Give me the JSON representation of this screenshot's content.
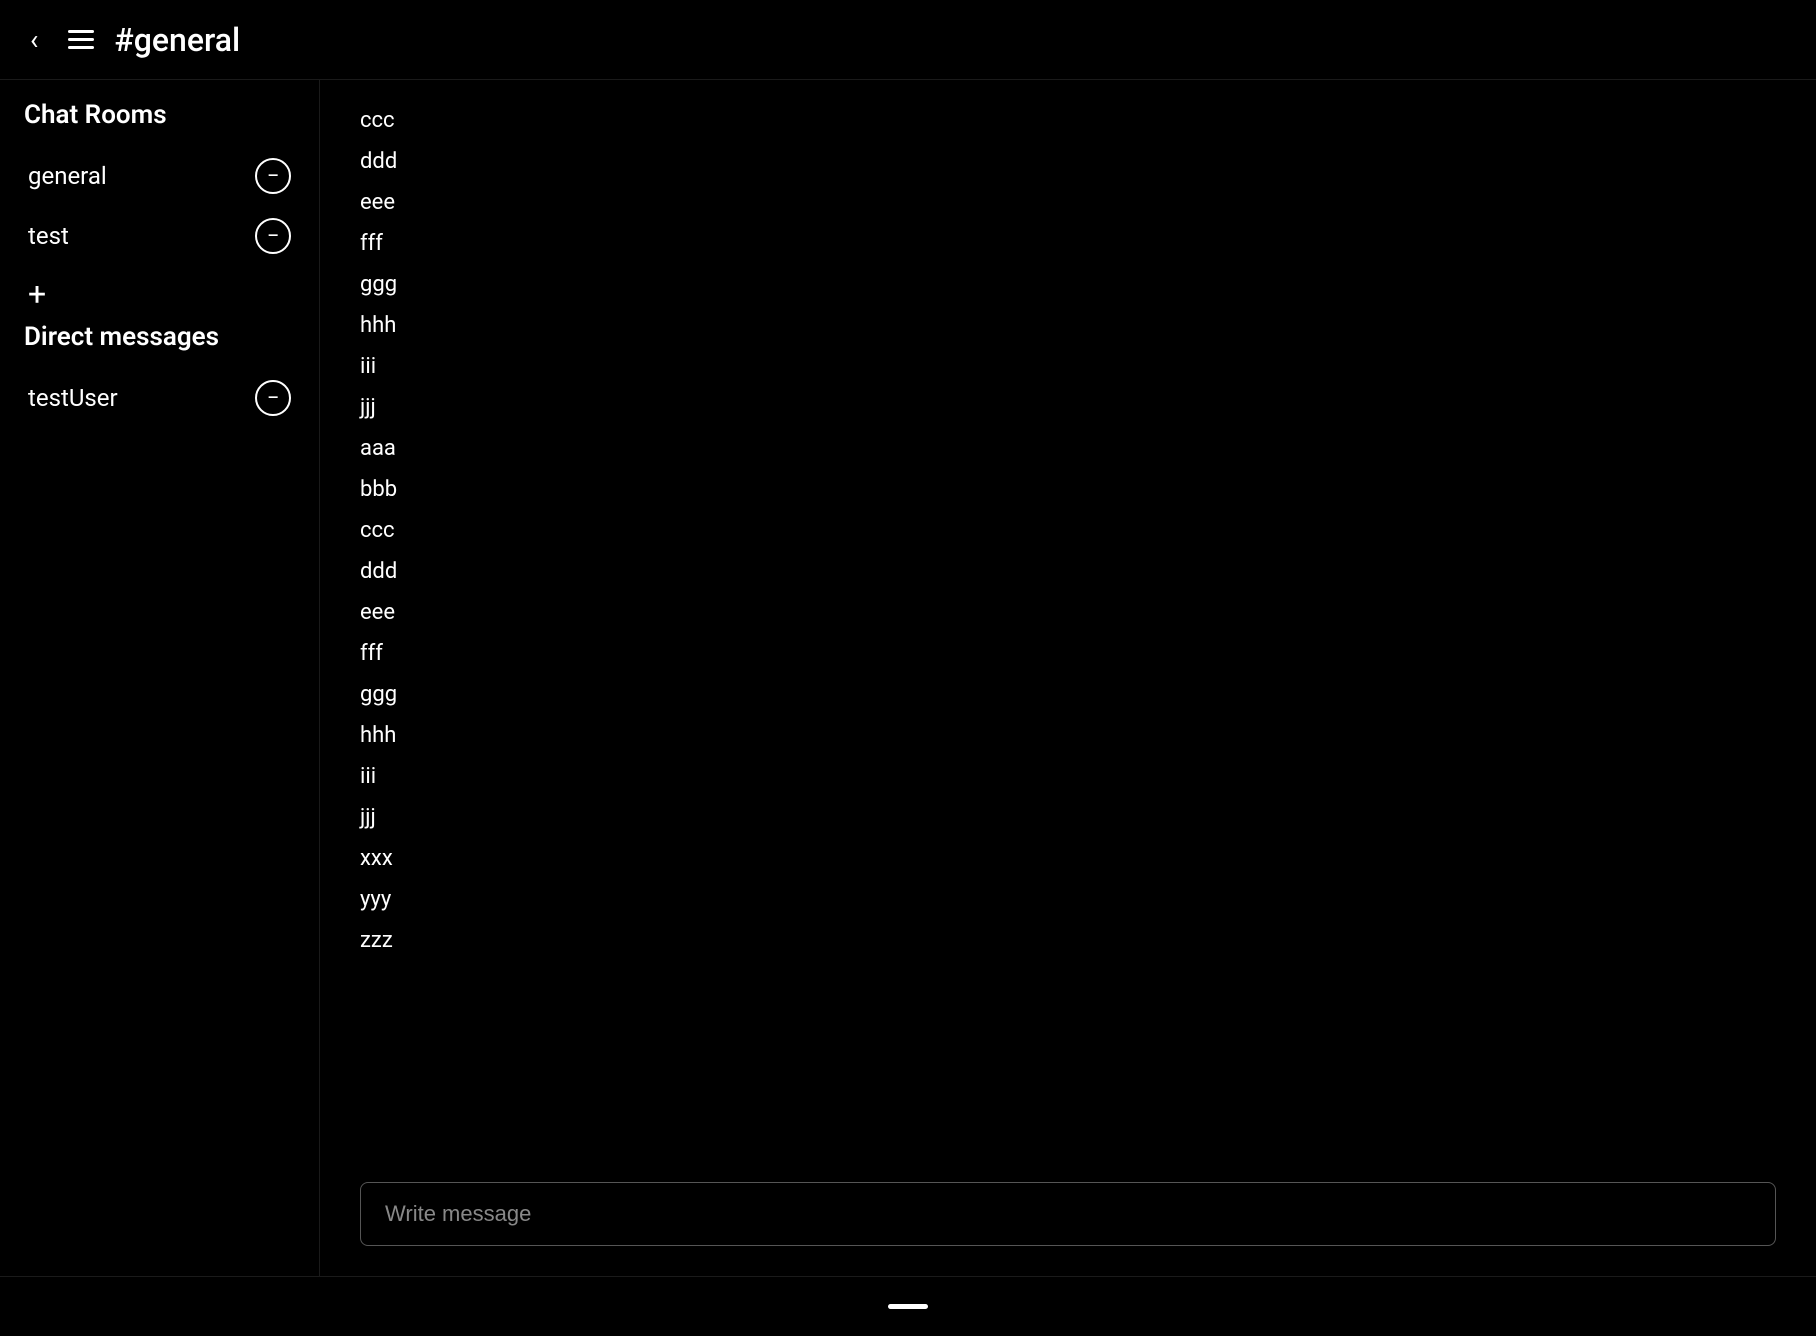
{
  "header": {
    "back_icon": "‹",
    "menu_icon": "hamburger",
    "title": "#general"
  },
  "sidebar": {
    "chat_rooms_title": "Chat Rooms",
    "chat_rooms": [
      {
        "label": "general",
        "id": "general"
      },
      {
        "label": "test",
        "id": "test"
      }
    ],
    "add_label": "+",
    "direct_messages_title": "Direct messages",
    "direct_messages": [
      {
        "label": "testUser",
        "id": "testUser"
      }
    ]
  },
  "messages": {
    "lines": [
      "ccc",
      "ddd",
      "eee",
      "fff",
      "ggg",
      "hhh",
      "iii",
      "jjj",
      "aaa",
      "bbb",
      "ccc",
      "ddd",
      "eee",
      "fff",
      "ggg",
      "hhh",
      "iii",
      "jjj",
      "xxx",
      "yyy",
      "zzz"
    ]
  },
  "input": {
    "placeholder": "Write message"
  }
}
